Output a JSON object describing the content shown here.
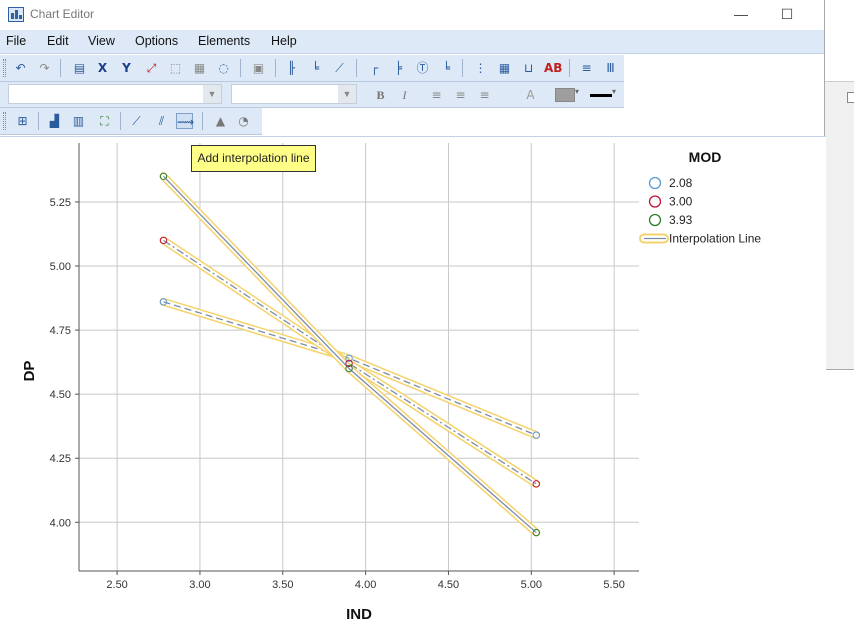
{
  "window": {
    "title": "Chart Editor",
    "minimize_label": "—",
    "maximize_label": "☐"
  },
  "menubar": {
    "items": [
      {
        "label": "File",
        "mnemonic": "F"
      },
      {
        "label": "Edit",
        "mnemonic": "E"
      },
      {
        "label": "View",
        "mnemonic": "V"
      },
      {
        "label": "Options",
        "mnemonic": "O"
      },
      {
        "label": "Elements",
        "mnemonic": "m"
      },
      {
        "label": "Help",
        "mnemonic": "H"
      }
    ]
  },
  "toolbar1": {
    "icons": [
      "undo-icon",
      "redo-icon",
      "properties-icon",
      "x-axis-select-icon",
      "y-axis-select-icon",
      "rescale-icon",
      "resize-icon",
      "data-icon",
      "lasso-icon",
      "hide-icon",
      "reference-line-x-icon",
      "reference-line-y-icon",
      "reference-line-equation-icon",
      "title-icon",
      "annotation-icon",
      "textbox-icon",
      "footnote-icon",
      "grid-x-icon",
      "grid-y-icon",
      "legend-icon",
      "data-labels-icon",
      "transpose-icon",
      "bar-options-icon"
    ]
  },
  "toolbar2": {
    "font_combo_value": "",
    "size_combo_value": "",
    "bold_label": "B",
    "italic_label": "I",
    "text_color_label": "A",
    "fill_color": "#9e9e9e",
    "line_color": "#000000"
  },
  "toolbar3": {
    "icons": [
      "scale-to-data-icon",
      "bar-chart-icon",
      "clustered-bar-icon",
      "scatter-fit-icon",
      "fit-line-total-icon",
      "fit-line-subgroups-icon",
      "interpolation-line-icon",
      "histogram-icon",
      "pie-icon"
    ]
  },
  "tooltip": {
    "text": "Add interpolation line"
  },
  "chart_data": {
    "type": "line",
    "xlabel": "IND",
    "ylabel": "DP",
    "xlim": [
      2.27,
      5.65
    ],
    "ylim": [
      3.81,
      5.48
    ],
    "xticks": [
      "2.50",
      "3.00",
      "3.50",
      "4.00",
      "4.50",
      "5.00",
      "5.50"
    ],
    "yticks": [
      "4.00",
      "4.25",
      "4.50",
      "4.75",
      "5.00",
      "5.25"
    ],
    "grid": true,
    "legend": {
      "title": "MOD",
      "placement": "right",
      "entries": [
        {
          "label": "2.08",
          "color": "#5b9bd5",
          "marker": "circle"
        },
        {
          "label": "3.00",
          "color": "#c0143c",
          "marker": "circle"
        },
        {
          "label": "3.93",
          "color": "#2e7d32",
          "marker": "circle"
        },
        {
          "label": "Interpolation Line",
          "marker": "line"
        }
      ]
    },
    "series": [
      {
        "name": "2.08",
        "x": [
          2.78,
          3.9,
          5.03
        ],
        "y": [
          4.86,
          4.64,
          4.34
        ]
      },
      {
        "name": "3.00",
        "x": [
          2.78,
          3.9,
          5.03
        ],
        "y": [
          5.1,
          4.62,
          4.15
        ]
      },
      {
        "name": "3.93",
        "x": [
          2.78,
          3.9,
          5.03
        ],
        "y": [
          5.35,
          4.6,
          3.96
        ]
      }
    ],
    "highlight_color": "#f5d36b",
    "line_color": "#7d8ba5"
  }
}
